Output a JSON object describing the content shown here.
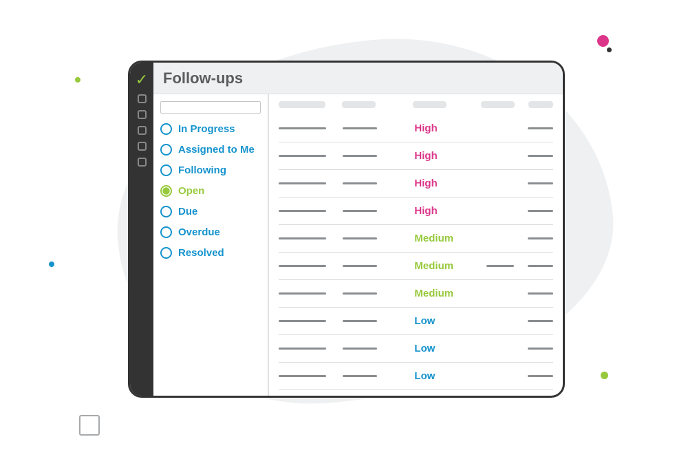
{
  "header": {
    "title": "Follow-ups"
  },
  "sidebar": {
    "filters": [
      {
        "label": "In Progress",
        "selected": false
      },
      {
        "label": "Assigned to Me",
        "selected": false
      },
      {
        "label": "Following",
        "selected": false
      },
      {
        "label": "Open",
        "selected": true
      },
      {
        "label": "Due",
        "selected": false
      },
      {
        "label": "Overdue",
        "selected": false
      },
      {
        "label": "Resolved",
        "selected": false
      }
    ]
  },
  "table": {
    "rows": [
      {
        "priority": "High",
        "has_c4": false
      },
      {
        "priority": "High",
        "has_c4": false
      },
      {
        "priority": "High",
        "has_c4": false
      },
      {
        "priority": "High",
        "has_c4": false
      },
      {
        "priority": "Medium",
        "has_c4": false
      },
      {
        "priority": "Medium",
        "has_c4": true
      },
      {
        "priority": "Medium",
        "has_c4": false
      },
      {
        "priority": "Low",
        "has_c4": false
      },
      {
        "priority": "Low",
        "has_c4": false
      },
      {
        "priority": "Low",
        "has_c4": false
      }
    ]
  },
  "colors": {
    "accent_green": "#97c93c",
    "accent_blue": "#1593cd",
    "accent_pink": "#dc368a",
    "frame_dark": "#333333",
    "bg_grey": "#eff0f1"
  }
}
